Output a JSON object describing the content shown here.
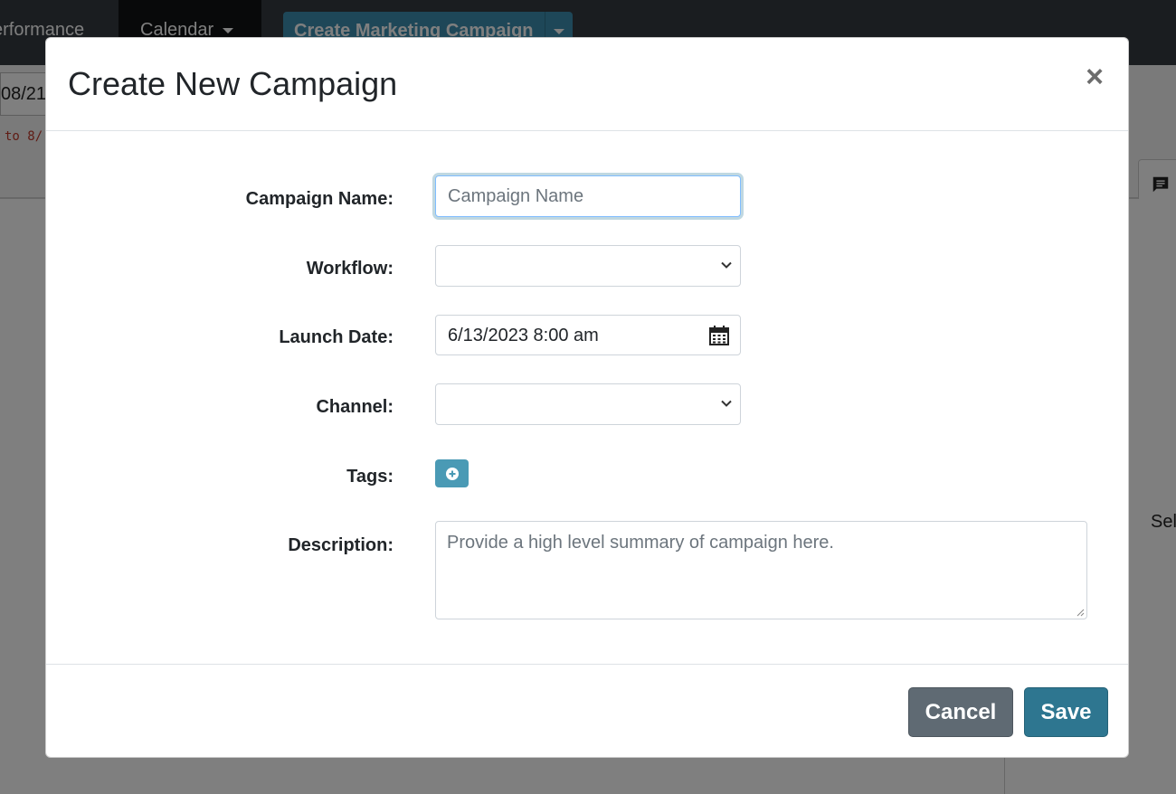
{
  "background": {
    "nav": {
      "performance_label": "erformance",
      "calendar_label": "Calendar",
      "create_campaign_label": "Create Marketing Campaign"
    },
    "date_value": "08/21/",
    "range_text": "to 8/",
    "right_panel_text": "Sel"
  },
  "modal": {
    "title": "Create New Campaign",
    "close_label": "×",
    "fields": {
      "campaign_name": {
        "label": "Campaign Name:",
        "placeholder": "Campaign Name",
        "value": ""
      },
      "workflow": {
        "label": "Workflow:",
        "value": ""
      },
      "launch_date": {
        "label": "Launch Date:",
        "value": "6/13/2023 8:00 am"
      },
      "channel": {
        "label": "Channel:",
        "value": ""
      },
      "tags": {
        "label": "Tags:"
      },
      "description": {
        "label": "Description:",
        "placeholder": "Provide a high level summary of campaign here."
      }
    },
    "footer": {
      "cancel_label": "Cancel",
      "save_label": "Save"
    }
  },
  "colors": {
    "nav_bg": "#343a40",
    "primary_button": "#3d8fb0",
    "save_button": "#2e7690",
    "cancel_button": "#5f6a73",
    "tags_button": "#4a9ab5"
  },
  "icons": {
    "close": "close-icon",
    "select_chevron": "chevron-down-icon",
    "calendar": "calendar-icon",
    "add": "plus-circle-icon",
    "chat": "chat-icon"
  }
}
